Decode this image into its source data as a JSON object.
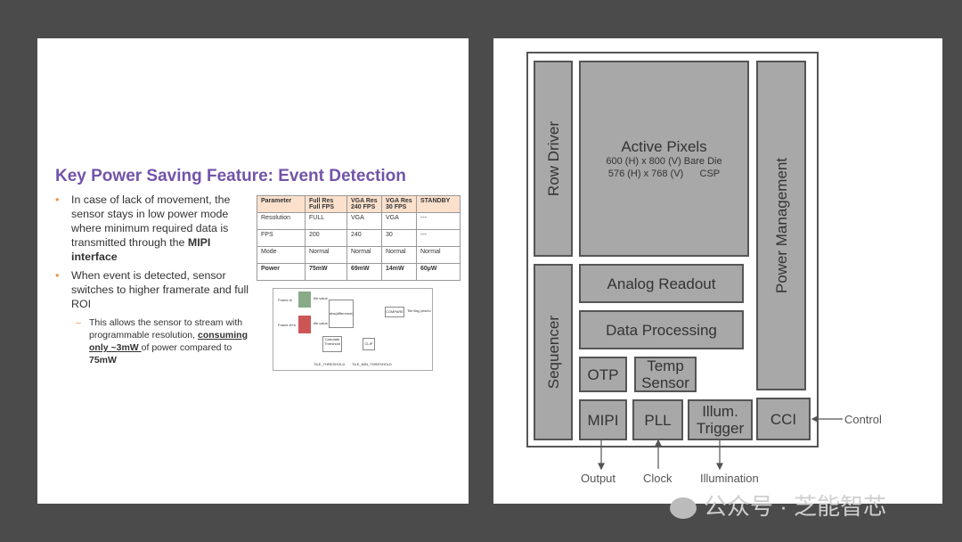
{
  "left_slide": {
    "title": "Key Power Saving Feature: Event Detection",
    "bullet1": {
      "text": "In case of lack of movement, the sensor stays in low power mode where minimum required data is transmitted through the ",
      "bold": "MIPI interface"
    },
    "bullet2": "When event is detected, sensor switches to higher framerate and full ROI",
    "sub_bullet": {
      "pre": "This allows the sensor to stream with programmable resolution, ",
      "underlined": "consuming only ~3mW ",
      "mid": "of power compared to ",
      "bold": "75mW"
    },
    "table": {
      "headers": [
        "Parameter",
        "Full Res Full FPS",
        "VGA Res 240 FPS",
        "VGA Res 30 FPS",
        "STANDBY"
      ],
      "rows": [
        [
          "Resolution",
          "FULL",
          "VGA",
          "VGA",
          "---"
        ],
        [
          "FPS",
          "200",
          "240",
          "30",
          "---"
        ],
        [
          "Mode",
          "Normal",
          "Normal",
          "Normal",
          "Normal"
        ],
        [
          "Power",
          "75mW",
          "69mW",
          "14mW",
          "60µW"
        ]
      ]
    },
    "flow": {
      "frame_n": "Frame #i",
      "frame_n1": "Frame #i+k",
      "value1": "tile value",
      "value2": "tile value",
      "abs": "abs(difference)",
      "compare": "COMPARE",
      "out": "Tile flag yes/no",
      "calc": "Calculate Threshold",
      "clip": "CLIP",
      "th1": "TILE_THRESHOLD",
      "th2": "TILE_MIN_THRESHOLD"
    }
  },
  "right_slide": {
    "blocks": {
      "row_driver": "Row Driver",
      "active_pixels": "Active Pixels",
      "ap_line1": "600 (H) x 800 (V) Bare Die",
      "ap_line2": "576 (H) x 768 (V)      CSP",
      "power": "Power Management",
      "sequencer": "Sequencer",
      "analog": "Analog Readout",
      "data": "Data Processing",
      "otp": "OTP",
      "temp": "Temp Sensor",
      "mipi": "MIPI",
      "pll": "PLL",
      "illum": "Illum. Trigger",
      "cci": "CCI"
    },
    "signals": {
      "output": "Output",
      "clock": "Clock",
      "illumination": "Illumination",
      "control": "Control"
    }
  },
  "watermark": "公众号 · 芝能智芯"
}
